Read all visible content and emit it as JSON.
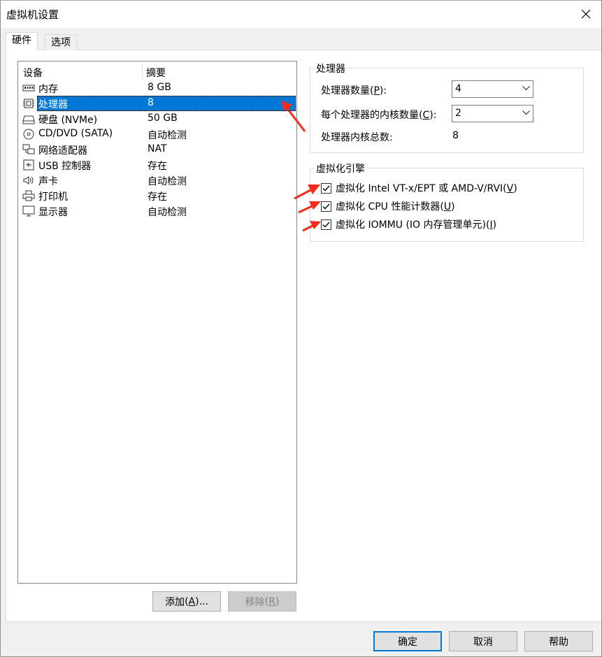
{
  "window": {
    "title": "虚拟机设置"
  },
  "tabs": [
    {
      "label": "硬件"
    },
    {
      "label": "选项"
    }
  ],
  "device_list": {
    "columns": [
      "设备",
      "摘要"
    ],
    "rows": [
      {
        "name": "内存",
        "summary": "8 GB",
        "icon": "memory-icon"
      },
      {
        "name": "处理器",
        "summary": "8",
        "icon": "processor-icon",
        "selected": true
      },
      {
        "name": "硬盘 (NVMe)",
        "summary": "50 GB",
        "icon": "hard-disk-icon"
      },
      {
        "name": "CD/DVD (SATA)",
        "summary": "自动检测",
        "icon": "cd-dvd-icon"
      },
      {
        "name": "网络适配器",
        "summary": "NAT",
        "icon": "network-adapter-icon"
      },
      {
        "name": "USB 控制器",
        "summary": "存在",
        "icon": "usb-controller-icon"
      },
      {
        "name": "声卡",
        "summary": "自动检测",
        "icon": "sound-card-icon"
      },
      {
        "name": "打印机",
        "summary": "存在",
        "icon": "printer-icon"
      },
      {
        "name": "显示器",
        "summary": "自动检测",
        "icon": "display-icon"
      }
    ],
    "add_button": {
      "text": "添加",
      "mnemonic": "A",
      "open": "(",
      "close": ")..."
    },
    "remove_button": {
      "text": "移除",
      "mnemonic": "R",
      "open": "(",
      "close": ")"
    }
  },
  "processor_group": {
    "title": "处理器",
    "count_label": {
      "text": "处理器数量",
      "mnemonic": "P",
      "open": "(",
      "close": "):"
    },
    "count_value": "4",
    "cores_label": {
      "text": "每个处理器的内核数量",
      "mnemonic": "C",
      "open": "(",
      "close": "):"
    },
    "cores_value": "2",
    "total_label": "处理器内核总数:",
    "total_value": "8"
  },
  "virtualization_group": {
    "title": "虚拟化引擎",
    "options": [
      {
        "text": "虚拟化 Intel VT-x/EPT 或 AMD-V/RVI",
        "mnemonic": "V",
        "open": "(",
        "close": ")",
        "checked": true
      },
      {
        "text": "虚拟化 CPU 性能计数器",
        "mnemonic": "U",
        "open": "(",
        "close": ")",
        "checked": true
      },
      {
        "text": "虚拟化 IOMMU (IO 内存管理单元)",
        "mnemonic": "I",
        "open": "(",
        "close": ")",
        "checked": true
      }
    ]
  },
  "footer": {
    "ok": "确定",
    "cancel": "取消",
    "help": "帮助"
  },
  "colors": {
    "selection": "#0078d7",
    "annotation_arrow": "#ff2a1a"
  }
}
